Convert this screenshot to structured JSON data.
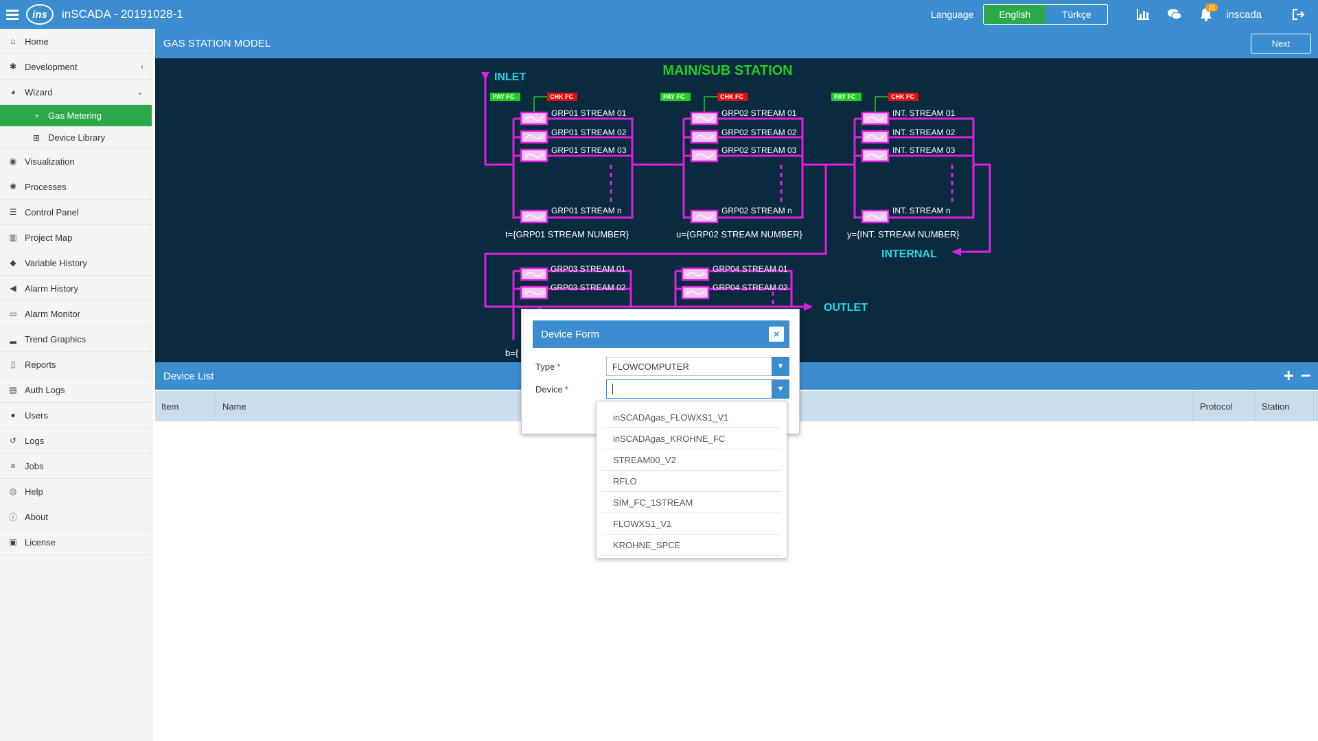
{
  "app": {
    "title": "inSCADA - 20191028-1",
    "logo_text": "ins"
  },
  "topbar": {
    "language_label": "Language",
    "languages": [
      {
        "label": "English",
        "active": true
      },
      {
        "label": "Türkçe",
        "active": false
      }
    ],
    "notification_count": "15",
    "user": "inscada"
  },
  "sidebar": {
    "items": [
      {
        "label": "Home",
        "icon": "home-icon"
      },
      {
        "label": "Development",
        "icon": "gear-icon"
      },
      {
        "label": "Wizard",
        "icon": "wizard-icon"
      },
      {
        "label": "Visualization",
        "icon": "eye-icon"
      },
      {
        "label": "Processes",
        "icon": "cog-icon"
      },
      {
        "label": "Control Panel",
        "icon": "panel-icon"
      },
      {
        "label": "Project Map",
        "icon": "map-icon"
      },
      {
        "label": "Variable History",
        "icon": "tag-icon"
      },
      {
        "label": "Alarm History",
        "icon": "megaphone-icon"
      },
      {
        "label": "Alarm Monitor",
        "icon": "monitor-icon"
      },
      {
        "label": "Trend Graphics",
        "icon": "bar-chart-icon"
      },
      {
        "label": "Reports",
        "icon": "file-icon"
      },
      {
        "label": "Auth Logs",
        "icon": "id-card-icon"
      },
      {
        "label": "Users",
        "icon": "user-icon"
      },
      {
        "label": "Logs",
        "icon": "history-icon"
      },
      {
        "label": "Jobs",
        "icon": "list-icon"
      },
      {
        "label": "Help",
        "icon": "globe-icon"
      },
      {
        "label": "About",
        "icon": "info-icon"
      },
      {
        "label": "License",
        "icon": "license-icon"
      }
    ],
    "wizard_sub": [
      {
        "label": "Gas Metering",
        "icon": "gauge-icon",
        "active": true
      },
      {
        "label": "Device Library",
        "icon": "sitemap-icon",
        "active": false
      }
    ]
  },
  "main": {
    "title": "GAS STATION MODEL",
    "next_label": "Next"
  },
  "diagram": {
    "title": "MAIN/SUB STATION",
    "inlet": "INLET",
    "outlet": "OUTLET",
    "internal": "INTERNAL",
    "pay_fc": "PAY FC",
    "chk_fc": "CHK FC",
    "grp01": [
      "GRP01 STREAM 01",
      "GRP01 STREAM 02",
      "GRP01 STREAM 03",
      "GRP01 STREAM n"
    ],
    "grp01_count": "t={GRP01 STREAM NUMBER}",
    "grp02": [
      "GRP02 STREAM 01",
      "GRP02 STREAM 02",
      "GRP02 STREAM 03",
      "GRP02 STREAM n"
    ],
    "grp02_count": "u={GRP02 STREAM NUMBER}",
    "int": [
      "INT. STREAM 01",
      "INT. STREAM 02",
      "INT. STREAM 03",
      "INT. STREAM n"
    ],
    "int_count": "y={INT. STREAM NUMBER}",
    "grp03": [
      "GRP03 STREAM 01",
      "GRP03 STREAM 02"
    ],
    "grp03_count_partial": "b={",
    "grp04": [
      "GRP04 STREAM 01",
      "GRP04 STREAM 02"
    ]
  },
  "device_list": {
    "title": "Device List",
    "columns": [
      "Item",
      "Name",
      "Protocol",
      "Station"
    ]
  },
  "modal": {
    "title": "Device Form",
    "type_label": "Type",
    "type_value": "FLOWCOMPUTER",
    "device_label": "Device",
    "device_value": "",
    "options": [
      "inSCADAgas_FLOWXS1_V1",
      "inSCADAgas_KROHNE_FC",
      "STREAM00_V2",
      "RFLO",
      "SIM_FC_1STREAM",
      "FLOWXS1_V1",
      "KROHNE_SPCE"
    ]
  },
  "colors": {
    "accent": "#3c8dcf",
    "active": "#2ba84a",
    "pipe": "#e020e0",
    "diagram_bg": "#0a2a3f",
    "title_green": "#22cc22",
    "cyan": "#20d8e8"
  }
}
